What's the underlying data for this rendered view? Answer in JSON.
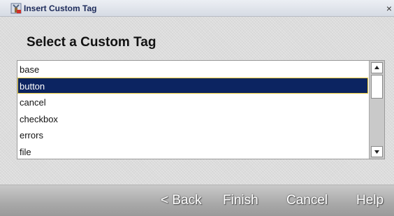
{
  "window": {
    "title": "Insert Custom Tag",
    "close_glyph": "×"
  },
  "heading": "Select a Custom Tag",
  "tags": {
    "items": [
      "base",
      "button",
      "cancel",
      "checkbox",
      "errors",
      "file"
    ],
    "selected": "button"
  },
  "buttons": {
    "back": "< Back",
    "finish": "Finish",
    "cancel": "Cancel",
    "help": "Help"
  },
  "icons": {
    "app": "tag-wizard-icon",
    "close": "close-icon",
    "scroll_up": "scroll-up-arrow-icon",
    "scroll_down": "scroll-down-arrow-icon"
  },
  "colors": {
    "selection_background": "#0c2461",
    "selection_border": "#e8c93a",
    "title_text": "#1c2a5a",
    "button_text": "#ffffff"
  }
}
